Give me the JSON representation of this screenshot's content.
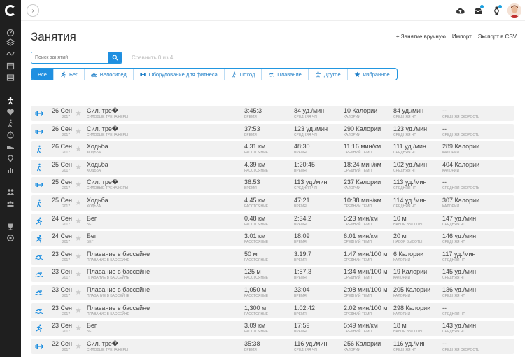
{
  "page": {
    "title": "Занятия",
    "add_manual": "+ Занятие вручную",
    "import": "Импорт",
    "export_csv": "Экспорт в CSV"
  },
  "search": {
    "placeholder": "Поиск занятий"
  },
  "compare": "Сравнить 0 из 4",
  "filters": [
    {
      "label": "Все",
      "icon": "none"
    },
    {
      "label": "Бег",
      "icon": "run-icon"
    },
    {
      "label": "Велосипед",
      "icon": "bike-icon"
    },
    {
      "label": "Оборудование для фитнеса",
      "icon": "dumbbell-icon"
    },
    {
      "label": "Поход",
      "icon": "hike-icon"
    },
    {
      "label": "Плавание",
      "icon": "swim-icon"
    },
    {
      "label": "Другое",
      "icon": "other-icon"
    },
    {
      "label": "Избранное",
      "icon": "star-icon"
    }
  ],
  "colors": {
    "accent": "#1f8fe0",
    "sidebar": "#1f1f1f",
    "row_bg": "#f1f1f1"
  },
  "activities": [
    {
      "type": "strength",
      "date": "26 Сен",
      "year": "2017",
      "name": "Сил. тре�",
      "sub": "Силовые тренажеры",
      "cells": [
        {
          "v": "3:45:3",
          "l": "Время"
        },
        {
          "v": "84 уд./мин",
          "l": "Средняя ЧП"
        },
        {
          "v": "10 Калории",
          "l": "Калории"
        },
        {
          "v": "84 уд./мин",
          "l": "Средняя ЧП"
        },
        {
          "v": "--",
          "l": "Средняя скорость"
        }
      ]
    },
    {
      "type": "strength",
      "date": "26 Сен",
      "year": "2017",
      "name": "Сил. тре�",
      "sub": "Силовые тренажеры",
      "cells": [
        {
          "v": "37:53",
          "l": "Время"
        },
        {
          "v": "123 уд./мин",
          "l": "Средняя ЧП"
        },
        {
          "v": "290 Калории",
          "l": "Калории"
        },
        {
          "v": "123 уд./мин",
          "l": "Средняя ЧП"
        },
        {
          "v": "--",
          "l": "Средняя скорость"
        }
      ]
    },
    {
      "type": "walk",
      "date": "26 Сен",
      "year": "2017",
      "name": "Ходьба",
      "sub": "Ходьба",
      "cells": [
        {
          "v": "4.31 км",
          "l": "Расстояние"
        },
        {
          "v": "48:30",
          "l": "Время"
        },
        {
          "v": "11:16 мин/км",
          "l": "Средний темп"
        },
        {
          "v": "111 уд./мин",
          "l": "Средняя ЧП"
        },
        {
          "v": "289 Калории",
          "l": "Калории"
        }
      ]
    },
    {
      "type": "walk",
      "date": "25 Сен",
      "year": "2017",
      "name": "Ходьба",
      "sub": "Ходьба",
      "cells": [
        {
          "v": "4.39 км",
          "l": "Расстояние"
        },
        {
          "v": "1:20:45",
          "l": "Время"
        },
        {
          "v": "18:24 мин/км",
          "l": "Средний темп"
        },
        {
          "v": "102 уд./мин",
          "l": "Средняя ЧП"
        },
        {
          "v": "404 Калории",
          "l": "Калории"
        }
      ]
    },
    {
      "type": "strength",
      "date": "25 Сен",
      "year": "2017",
      "name": "Сил. тре�",
      "sub": "Силовые тренажеры",
      "cells": [
        {
          "v": "36:53",
          "l": "Время"
        },
        {
          "v": "113 уд./мин",
          "l": "Средняя ЧП"
        },
        {
          "v": "237 Калории",
          "l": "Калории"
        },
        {
          "v": "113 уд./мин",
          "l": "Средняя ЧП"
        },
        {
          "v": "--",
          "l": "Средняя скорость"
        }
      ]
    },
    {
      "type": "walk",
      "date": "25 Сен",
      "year": "2017",
      "name": "Ходьба",
      "sub": "Ходьба",
      "cells": [
        {
          "v": "4.45 км",
          "l": "Расстояние"
        },
        {
          "v": "47:21",
          "l": "Время"
        },
        {
          "v": "10:38 мин/км",
          "l": "Средний темп"
        },
        {
          "v": "114 уд./мин",
          "l": "Средняя ЧП"
        },
        {
          "v": "307 Калории",
          "l": "Калории"
        }
      ]
    },
    {
      "type": "run",
      "date": "24 Сен",
      "year": "2017",
      "name": "Бег",
      "sub": "Бег",
      "cells": [
        {
          "v": "0.48 км",
          "l": "Расстояние"
        },
        {
          "v": "2:34.2",
          "l": "Время"
        },
        {
          "v": "5:23 мин/км",
          "l": "Средний темп"
        },
        {
          "v": "10 м",
          "l": "Набор высоты"
        },
        {
          "v": "147 уд./мин",
          "l": "Средняя ЧП"
        }
      ]
    },
    {
      "type": "run",
      "date": "24 Сен",
      "year": "2017",
      "name": "Бег",
      "sub": "Бег",
      "cells": [
        {
          "v": "3.01 км",
          "l": "Расстояние"
        },
        {
          "v": "18:09",
          "l": "Время"
        },
        {
          "v": "6:01 мин/км",
          "l": "Средний темп"
        },
        {
          "v": "20 м",
          "l": "Набор высоты"
        },
        {
          "v": "146 уд./мин",
          "l": "Средняя ЧП"
        }
      ]
    },
    {
      "type": "swim",
      "date": "23 Сен",
      "year": "2017",
      "name": "Плавание в бассейне",
      "sub": "Плавание в бассейне",
      "cells": [
        {
          "v": "50 м",
          "l": "Расстояние"
        },
        {
          "v": "3:19.7",
          "l": "Время"
        },
        {
          "v": "1:47 мин/100 м",
          "l": "Средний темп"
        },
        {
          "v": "6 Калории",
          "l": "Калории"
        },
        {
          "v": "117 уд./мин",
          "l": "Средняя ЧП"
        }
      ]
    },
    {
      "type": "swim",
      "date": "23 Сен",
      "year": "2017",
      "name": "Плавание в бассейне",
      "sub": "Плавание в бассейне",
      "cells": [
        {
          "v": "125 м",
          "l": "Расстояние"
        },
        {
          "v": "1:57.3",
          "l": "Время"
        },
        {
          "v": "1:34 мин/100 м",
          "l": "Средний темп"
        },
        {
          "v": "19 Калории",
          "l": "Калории"
        },
        {
          "v": "145 уд./мин",
          "l": "Средняя ЧП"
        }
      ]
    },
    {
      "type": "swim",
      "date": "23 Сен",
      "year": "2017",
      "name": "Плавание в бассейне",
      "sub": "Плавание в бассейне",
      "cells": [
        {
          "v": "1,050 м",
          "l": "Расстояние"
        },
        {
          "v": "23:04",
          "l": "Время"
        },
        {
          "v": "2:08 мин/100 м",
          "l": "Средний темп"
        },
        {
          "v": "205 Калории",
          "l": "Калории"
        },
        {
          "v": "136 уд./мин",
          "l": "Средняя ЧП"
        }
      ]
    },
    {
      "type": "swim",
      "date": "23 Сен",
      "year": "2017",
      "name": "Плавание в бассейне",
      "sub": "Плавание в бассейне",
      "cells": [
        {
          "v": "1,300 м",
          "l": "Расстояние"
        },
        {
          "v": "1:02:42",
          "l": "Время"
        },
        {
          "v": "2:02 мин/100 м",
          "l": "Средний темп"
        },
        {
          "v": "298 Калории",
          "l": "Калории"
        },
        {
          "v": "--",
          "l": "Средняя ЧП"
        }
      ]
    },
    {
      "type": "run",
      "date": "23 Сен",
      "year": "2017",
      "name": "Бег",
      "sub": "Бег",
      "cells": [
        {
          "v": "3.09 км",
          "l": "Расстояние"
        },
        {
          "v": "17:59",
          "l": "Время"
        },
        {
          "v": "5:49 мин/км",
          "l": "Средний темп"
        },
        {
          "v": "18 м",
          "l": "Набор высоты"
        },
        {
          "v": "143 уд./мин",
          "l": "Средняя ЧП"
        }
      ]
    },
    {
      "type": "strength",
      "date": "22 Сен",
      "year": "2017",
      "name": "Сил. тре�",
      "sub": "Силовые тренажеры",
      "cells": [
        {
          "v": "35:38",
          "l": "Время"
        },
        {
          "v": "116 уд./мин",
          "l": "Средняя ЧП"
        },
        {
          "v": "256 Калории",
          "l": "Калории"
        },
        {
          "v": "116 уд./мин",
          "l": "Средняя ЧП"
        },
        {
          "v": "--",
          "l": "Средняя скорость"
        }
      ]
    }
  ]
}
